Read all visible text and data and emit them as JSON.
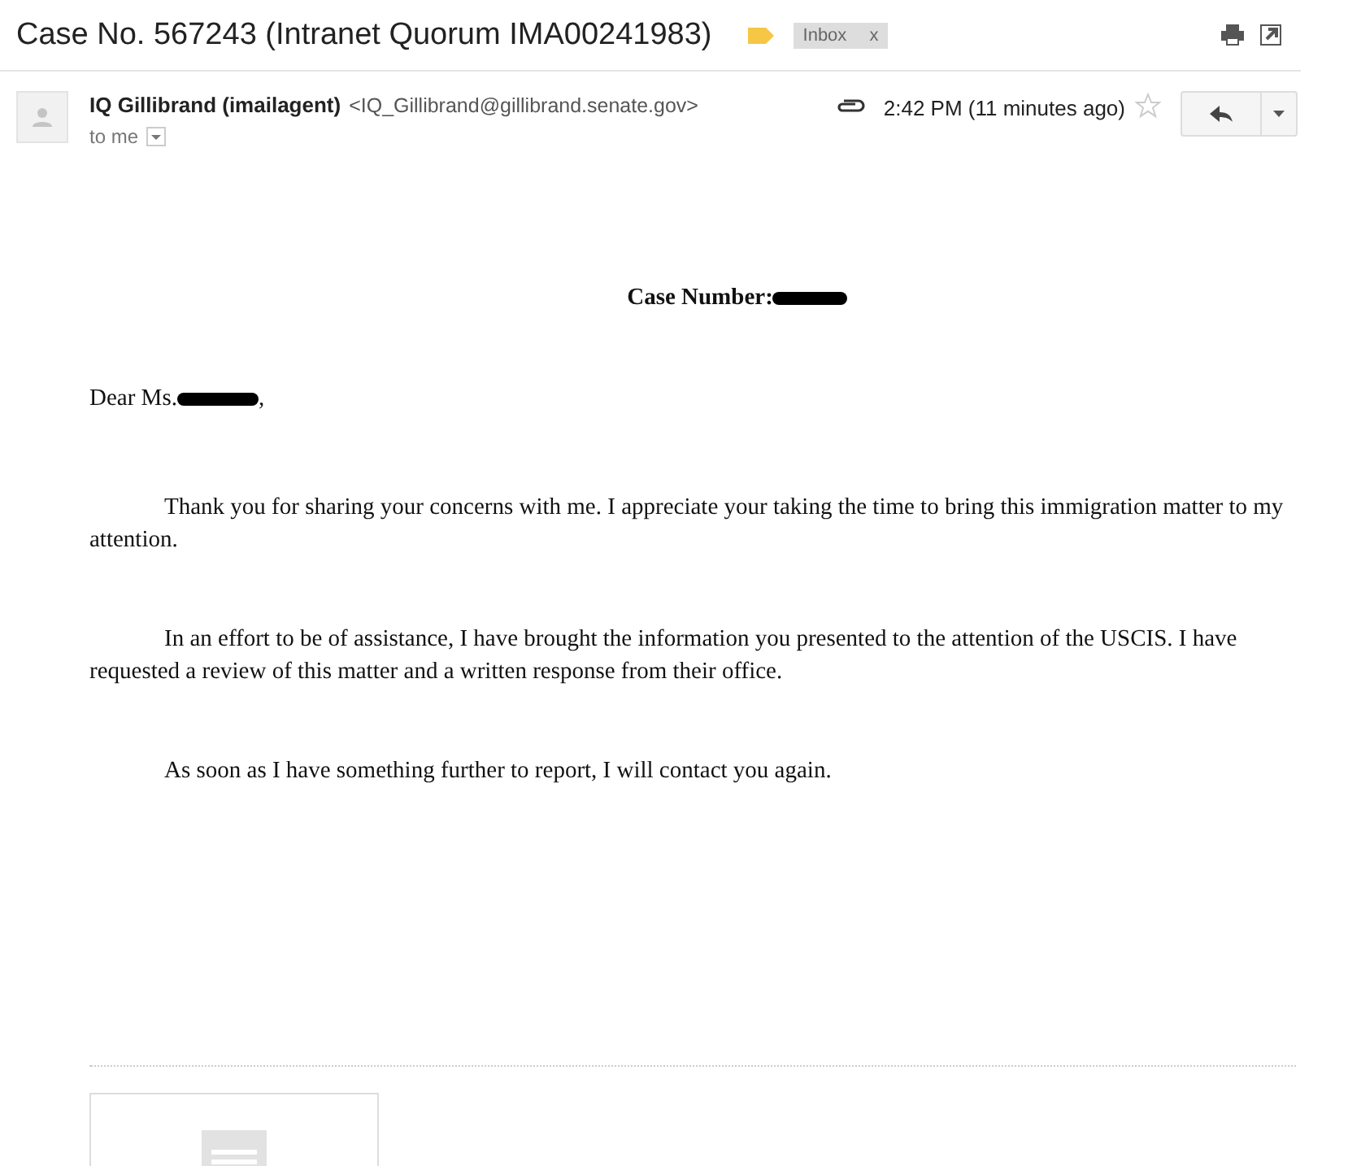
{
  "subject": "Case No. 567243 (Intranet Quorum IMA00241983)",
  "label": {
    "text": "Inbox",
    "close": "x"
  },
  "sender": {
    "name": "IQ Gillibrand (imailagent)",
    "email": "<IQ_Gillibrand@gillibrand.senate.gov>",
    "recipient": "to me",
    "time": "2:42 PM (11 minutes ago)",
    "starred": false
  },
  "letter": {
    "case_label": "Case Number:",
    "salutation": "Dear Ms.",
    "salutation_end": ",",
    "paragraphs": [
      "Thank you for sharing your concerns with me. I appreciate your taking the time to bring this immigration matter to my attention.",
      "In an effort to be of assistance, I have brought the information you presented to the attention of the USCIS. I have requested a review of this matter and a written response from their office.",
      "As soon as I have something further to report, I will contact you again."
    ]
  }
}
